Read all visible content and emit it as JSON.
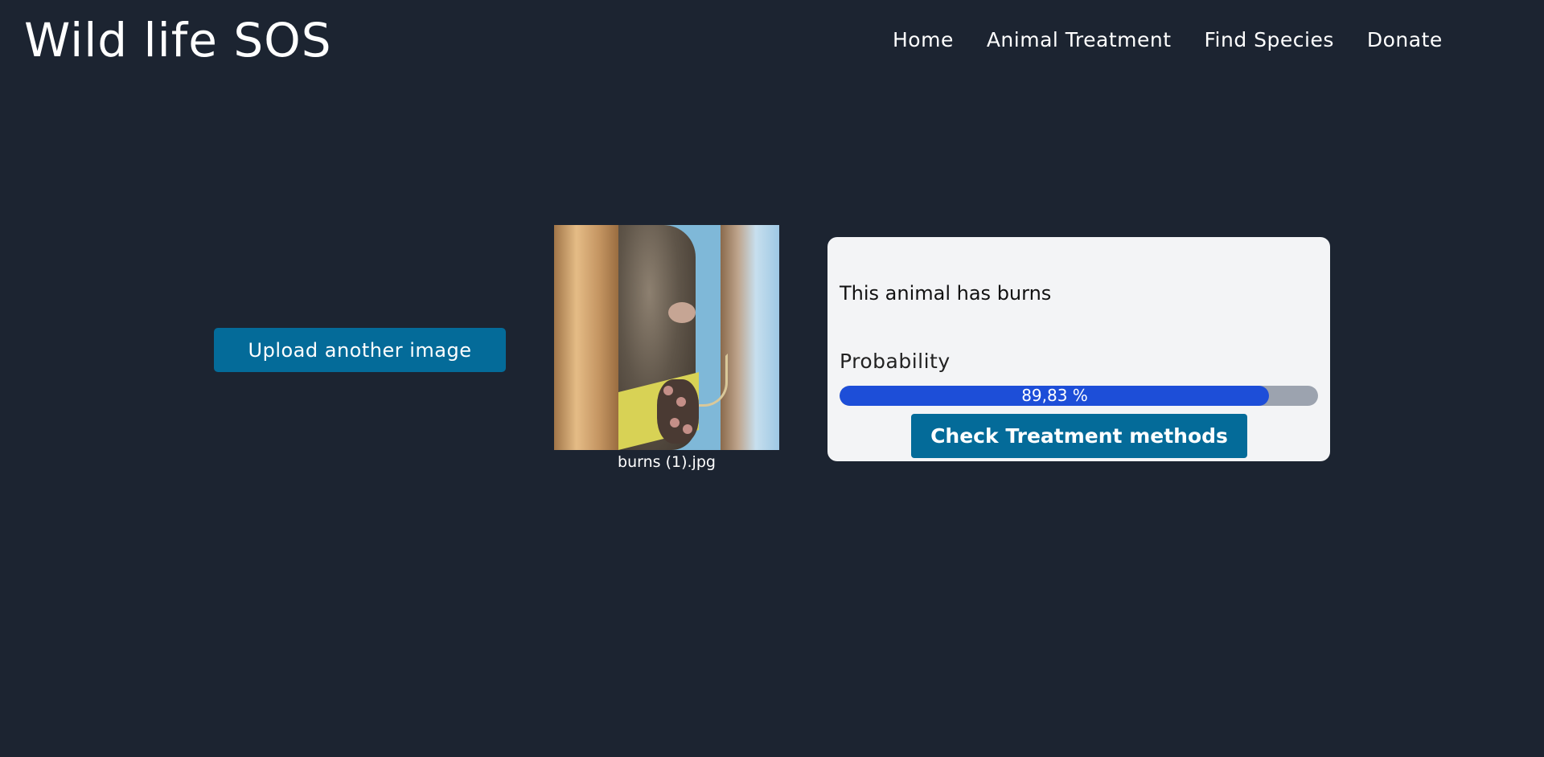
{
  "header": {
    "brand": "Wild life SOS",
    "nav": [
      {
        "label": "Home"
      },
      {
        "label": "Animal Treatment"
      },
      {
        "label": "Find Species"
      },
      {
        "label": "Donate"
      }
    ]
  },
  "upload": {
    "button_label": "Upload another image"
  },
  "preview": {
    "filename": "burns (1).jpg"
  },
  "result": {
    "title": "This animal has burns",
    "probability_label": "Probability",
    "probability_value": 89.83,
    "probability_text": "89,83 %",
    "treatment_button_label": "Check Treatment methods"
  },
  "colors": {
    "background": "#1c2431",
    "button": "#046b99",
    "card": "#f3f4f6",
    "progress_fill": "#1d4ed8",
    "progress_track": "#9ca3af"
  }
}
